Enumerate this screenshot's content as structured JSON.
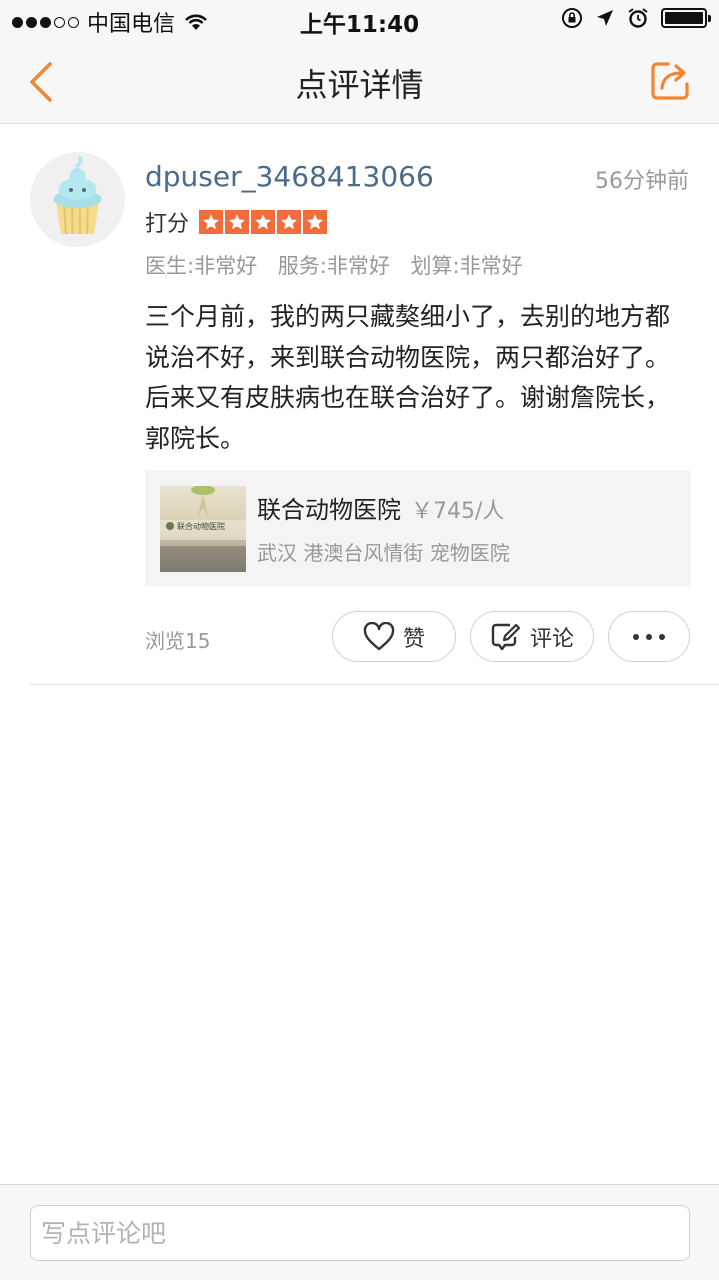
{
  "status_bar": {
    "carrier": "中国电信",
    "time": "上午11:40"
  },
  "nav": {
    "title": "点评详情"
  },
  "review": {
    "username": "dpuser_3468413066",
    "time_ago": "56分钟前",
    "score_label": "打分",
    "rating_stars": 5,
    "subscores": [
      "医生:非常好",
      "服务:非常好",
      "划算:非常好"
    ],
    "text": "三个月前，我的两只藏獒细小了，去别的地方都说治不好，来到联合动物医院，两只都治好了。后来又有皮肤病也在联合治好了。谢谢詹院长，郭院长。"
  },
  "shop": {
    "name": "联合动物医院",
    "price": "￥745/人",
    "meta": "武汉 港澳台风情街 宠物医院",
    "thumb_sign_text": "联合动物医院"
  },
  "actions": {
    "views": "浏览15",
    "like_label": "赞",
    "comment_label": "评论"
  },
  "comment_bar": {
    "placeholder": "写点评论吧"
  },
  "colors": {
    "accent": "#f08532",
    "star": "#f36c3c",
    "username": "#4a6b8a",
    "muted": "#999999"
  }
}
